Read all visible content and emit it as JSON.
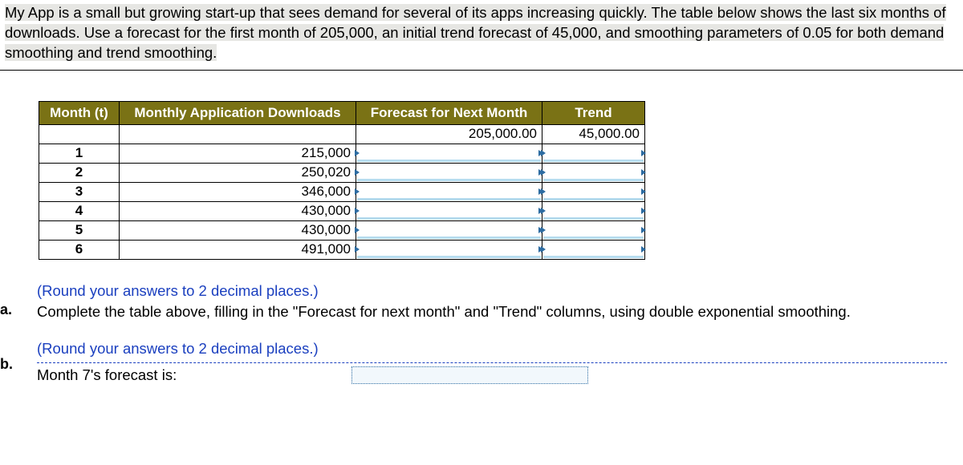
{
  "intro": "My App is a small but growing start-up that sees demand for several of its apps increasing quickly. The table below shows the last six months of downloads. Use a forecast for the first month of 205,000, an initial trend forecast of 45,000, and smoothing parameters of 0.05 for both demand smoothing and trend smoothing.",
  "table": {
    "headers": {
      "month": "Month (t)",
      "downloads": "Monthly Application Downloads",
      "forecast": "Forecast for Next Month",
      "trend": "Trend"
    },
    "initial": {
      "forecast": "205,000.00",
      "trend": "45,000.00"
    },
    "rows": [
      {
        "month": "1",
        "downloads": "215,000"
      },
      {
        "month": "2",
        "downloads": "250,020"
      },
      {
        "month": "3",
        "downloads": "346,000"
      },
      {
        "month": "4",
        "downloads": "430,000"
      },
      {
        "month": "5",
        "downloads": "430,000"
      },
      {
        "month": "6",
        "downloads": "491,000"
      }
    ]
  },
  "qa": {
    "label": "a.",
    "round": "(Round your answers to 2 decimal places.)",
    "text": "Complete the table above, filling in the \"Forecast for next month\" and \"Trend\" columns, using double exponential smoothing."
  },
  "qb": {
    "label": "b.",
    "round": "(Round your answers to 2 decimal places.)",
    "text": "Month 7's forecast is:"
  }
}
